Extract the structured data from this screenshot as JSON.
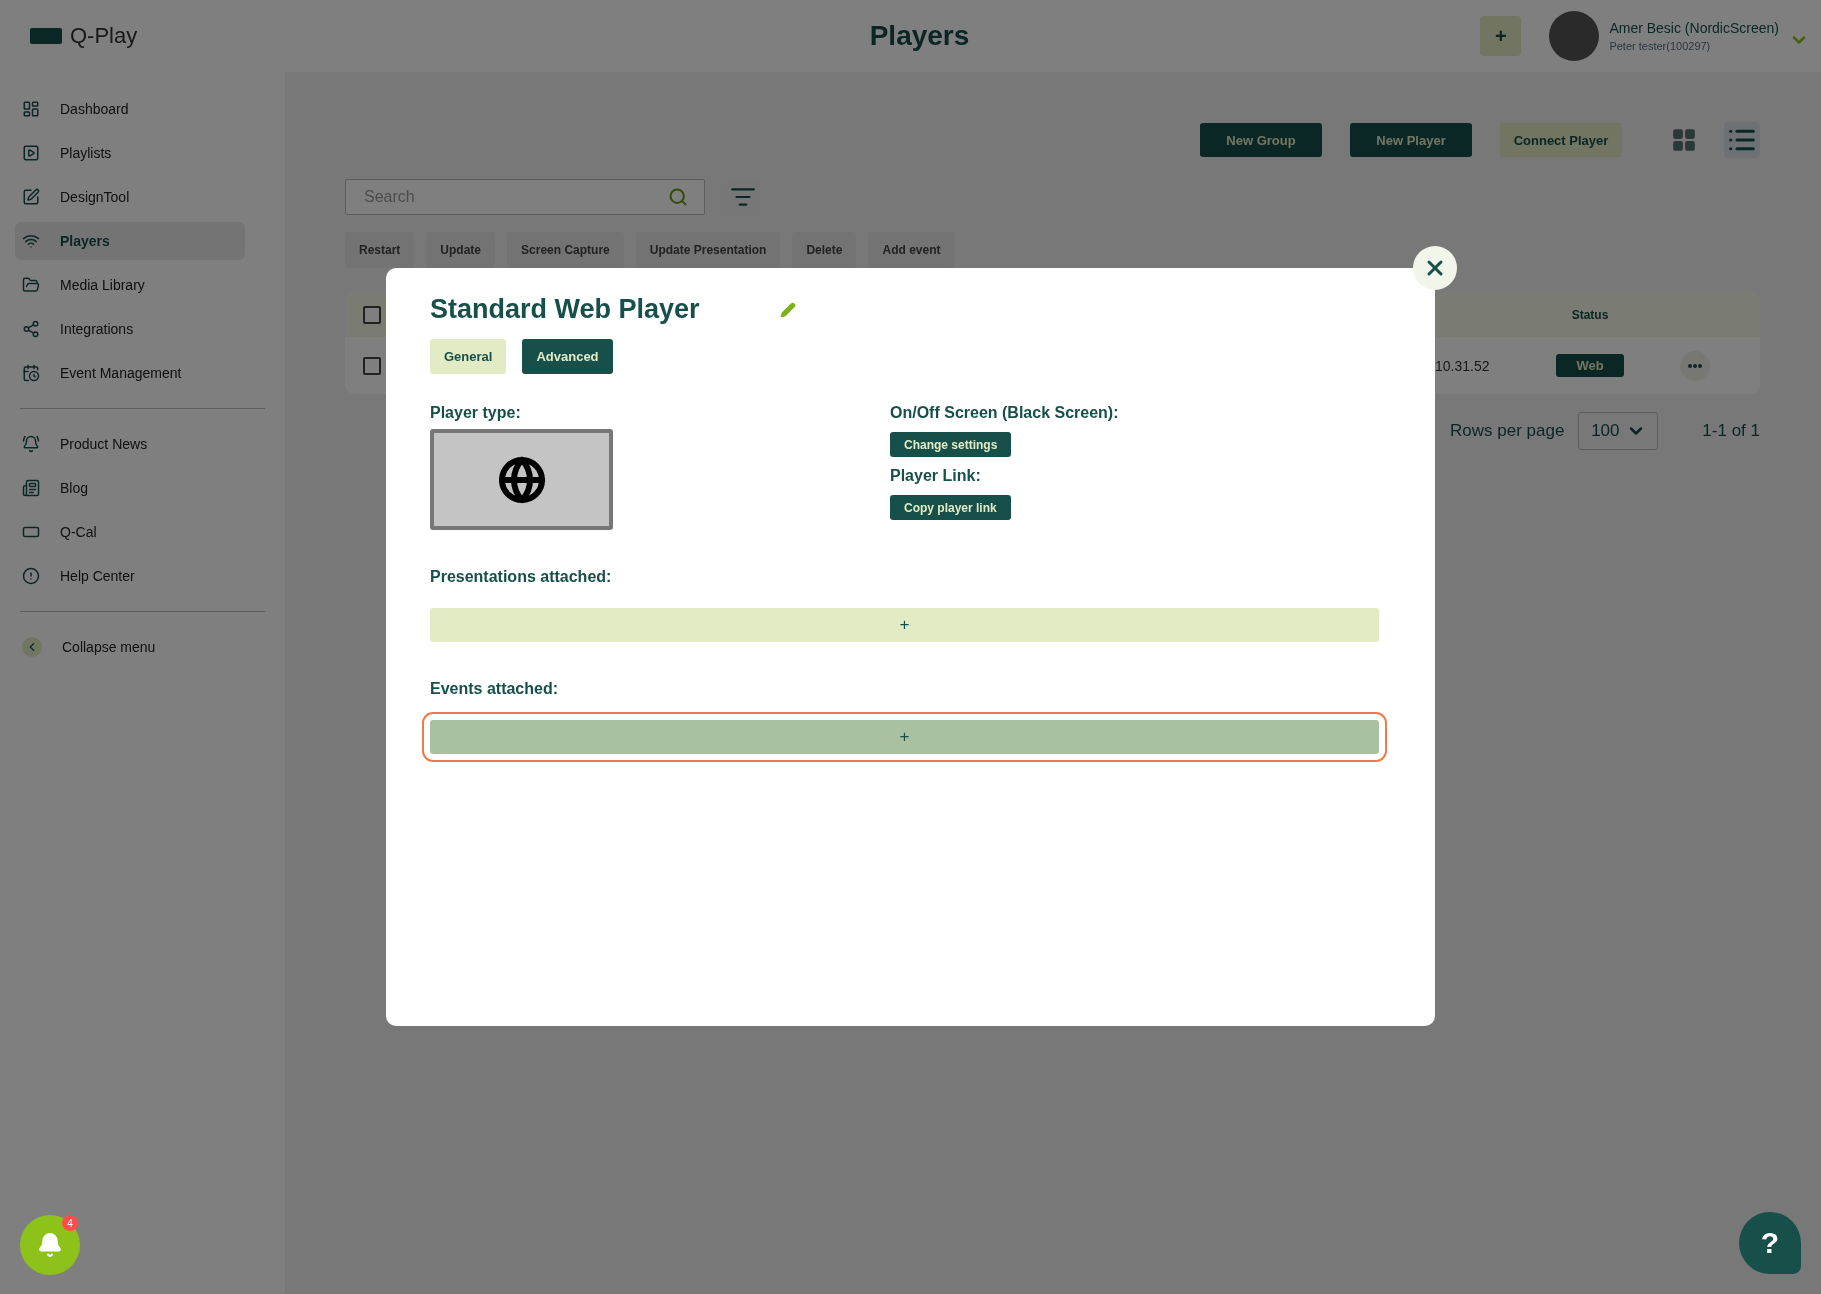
{
  "app": {
    "logo": "Q-Play"
  },
  "header": {
    "title": "Players",
    "add_label": "+",
    "user": {
      "name": "Amer Besic (NordicScreen)",
      "subtitle": "Peter tester(100297)"
    }
  },
  "sidebar": {
    "sections": [
      [
        {
          "label": "Dashboard",
          "selected": false
        },
        {
          "label": "Playlists",
          "selected": false
        },
        {
          "label": "DesignTool",
          "selected": false
        },
        {
          "label": "Players",
          "selected": true
        },
        {
          "label": "Media Library",
          "selected": false
        },
        {
          "label": "Integrations",
          "selected": false
        },
        {
          "label": "Event Management",
          "selected": false
        }
      ],
      [
        {
          "label": "Product News",
          "selected": false
        },
        {
          "label": "Blog",
          "selected": false
        },
        {
          "label": "Q-Cal",
          "selected": false
        },
        {
          "label": "Help Center",
          "selected": false
        }
      ]
    ],
    "collapse": "Collapse menu"
  },
  "toolbar": {
    "buttons": [
      {
        "label": "New Group",
        "kind": "dark"
      },
      {
        "label": "New Player",
        "kind": "dark"
      },
      {
        "label": "Connect Player",
        "kind": "light"
      }
    ],
    "views": [
      {
        "kind": "grid",
        "selected": false
      },
      {
        "kind": "list",
        "selected": true
      }
    ]
  },
  "search": {
    "placeholder": "Search"
  },
  "actions": [
    "Restart",
    "Update",
    "Screen Capture",
    "Update Presentation",
    "Delete",
    "Add event"
  ],
  "table": {
    "header": {
      "checked": false,
      "status_label": "Status"
    },
    "rows": [
      {
        "checked": false,
        "column_3": "10.31.52",
        "status": "Web"
      }
    ]
  },
  "pagination": {
    "rows_per_page_label": "Rows per page",
    "rows_per_page": "100",
    "range": "1-1 of 1"
  },
  "modal": {
    "title": "Standard Web Player",
    "tabs": [
      {
        "label": "General",
        "selected": false
      },
      {
        "label": "Advanced",
        "selected": true
      }
    ],
    "player_type": {
      "label": "Player type:"
    },
    "on_off": {
      "label": "On/Off Screen (Black Screen):",
      "button": "Change settings"
    },
    "player_link": {
      "label": "Player Link:",
      "button": "Copy player link"
    },
    "attachments": [
      {
        "label": "Presentations attached:",
        "button": "+",
        "highlighted": false
      },
      {
        "label": "Events attached:",
        "button": "+",
        "highlighted": true
      }
    ]
  },
  "notifications": {
    "count": "4"
  },
  "help": {
    "label": "?"
  }
}
